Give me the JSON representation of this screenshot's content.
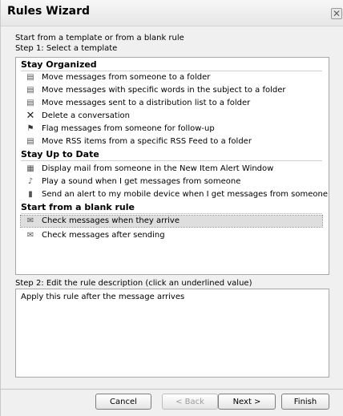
{
  "window": {
    "title": "Rules Wizard",
    "close_icon": "close-icon"
  },
  "intro": {
    "line1": "Start from a template or from a blank rule",
    "line2": "Step 1: Select a template"
  },
  "groups": [
    {
      "header": "Stay Organized",
      "items": [
        {
          "label": "Move messages from someone to a folder",
          "icon": "folder-move-icon"
        },
        {
          "label": "Move messages with specific words in the subject to a folder",
          "icon": "folder-move-icon"
        },
        {
          "label": "Move messages sent to a distribution list to a folder",
          "icon": "folder-move-icon"
        },
        {
          "label": "Delete a conversation",
          "icon": "delete-icon"
        },
        {
          "label": "Flag messages from someone for follow-up",
          "icon": "flag-icon"
        },
        {
          "label": "Move RSS items from a specific RSS Feed to a folder",
          "icon": "folder-move-icon"
        }
      ]
    },
    {
      "header": "Stay Up to Date",
      "items": [
        {
          "label": "Display mail from someone in the New Item Alert Window",
          "icon": "alert-window-icon"
        },
        {
          "label": "Play a sound when I get messages from someone",
          "icon": "sound-icon"
        },
        {
          "label": "Send an alert to my mobile device when I get messages from someone",
          "icon": "mobile-icon"
        }
      ]
    },
    {
      "header": "Start from a blank rule",
      "items": [
        {
          "label": "Check messages when they arrive",
          "icon": "envelope-icon",
          "selected": true
        },
        {
          "label": "Check messages after sending",
          "icon": "sent-envelope-icon"
        }
      ]
    }
  ],
  "step2": {
    "label": "Step 2: Edit the rule description (click an underlined value)",
    "description": "Apply this rule after the message arrives"
  },
  "buttons": {
    "cancel": "Cancel",
    "back": "< Back",
    "next": "Next >",
    "finish": "Finish"
  }
}
